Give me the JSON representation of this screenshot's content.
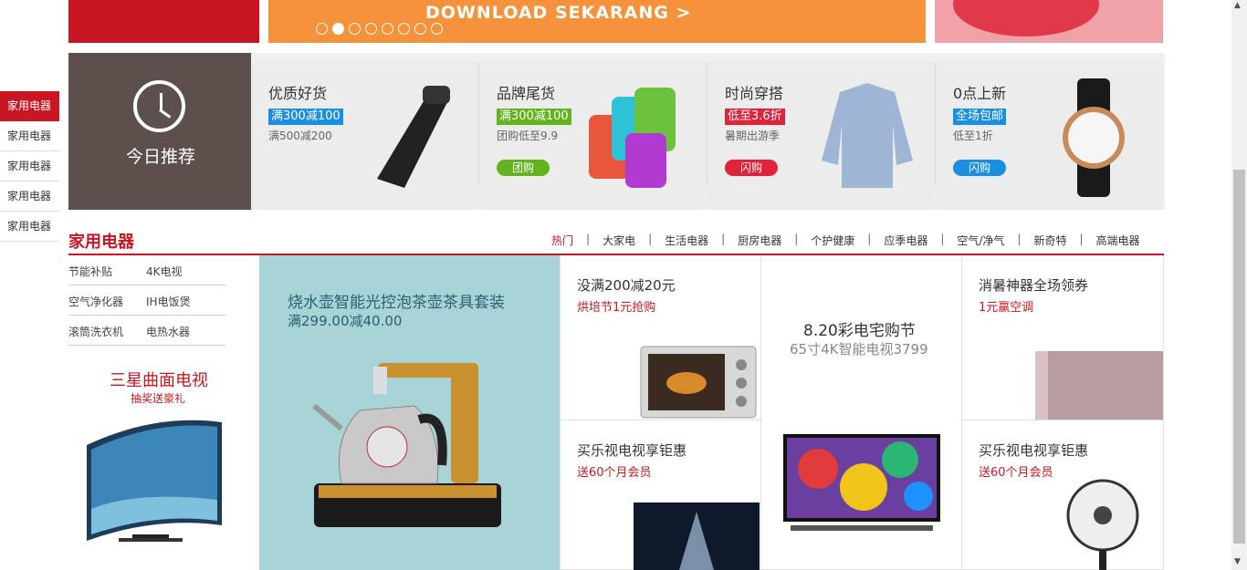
{
  "banner": {
    "download_text": "DOWNLOAD SEKARANG",
    "download_arrow": ">",
    "dots_total": 8,
    "dots_active_index": 1
  },
  "side_nav": {
    "items": [
      "家用电器",
      "家用电器",
      "家用电器",
      "家用电器",
      "家用电器"
    ],
    "active_index": 0
  },
  "today": {
    "label": "今日推荐",
    "icon": "clock-icon"
  },
  "recommendations": [
    {
      "title": "优质好货",
      "tag": "满300减100",
      "tag_color": "#1a8ee1",
      "sub": "满500减200",
      "button": "",
      "image": "handheld-vacuum"
    },
    {
      "title": "品牌尾货",
      "tag": "满300减100",
      "tag_color": "#62b41c",
      "sub": "团购低至9.9",
      "button": "团购",
      "button_color": "#62b41c",
      "image": "towels"
    },
    {
      "title": "时尚穿搭",
      "tag": "低至3.6折",
      "tag_color": "#e0223a",
      "sub": "暑期出游季",
      "button": "闪购",
      "button_color": "#e0223a",
      "image": "blouse"
    },
    {
      "title": "0点上新",
      "tag": "全场包邮",
      "tag_color": "#1a8ee1",
      "sub": "低至1折",
      "button": "闪购",
      "button_color": "#1a8ee1",
      "image": "watch"
    }
  ],
  "section": {
    "title": "家用电器",
    "tabs": [
      "热门",
      "大家电",
      "生活电器",
      "厨房电器",
      "个护健康",
      "应季电器",
      "空气/净气",
      "新奇特",
      "高端电器"
    ],
    "active_tab_index": 0
  },
  "subcategories": [
    [
      "节能补贴",
      "4K电视"
    ],
    [
      "空气净化器",
      "IH电饭煲"
    ],
    [
      "滚筒洗衣机",
      "电热水器"
    ]
  ],
  "samsung": {
    "title": "三星曲面电视",
    "sub": "抽奖送豪礼"
  },
  "kettle": {
    "title": "烧水壶智能光控泡茶壶茶具套装",
    "sub": "满299.00减40.00"
  },
  "grid": {
    "oven": {
      "title": "没满200减20元",
      "sub": "烘培节1元抢购"
    },
    "tv_center": {
      "title": "8.20彩电宅购节",
      "sub": "65寸4K智能电视3799"
    },
    "aircon": {
      "title": "消暑神器全场领券",
      "sub": "1元赢空调"
    },
    "letv_left": {
      "title": "买乐视电视享钜惠",
      "sub": "送60个月会员"
    },
    "letv_right": {
      "title": "买乐视电视享钜惠",
      "sub": "送60个月会员"
    }
  },
  "colors": {
    "brand_red": "#c81623",
    "banner_orange": "#f6923b",
    "today_bg": "#5d4f4c",
    "kettle_bg": "#a8d4d8"
  }
}
